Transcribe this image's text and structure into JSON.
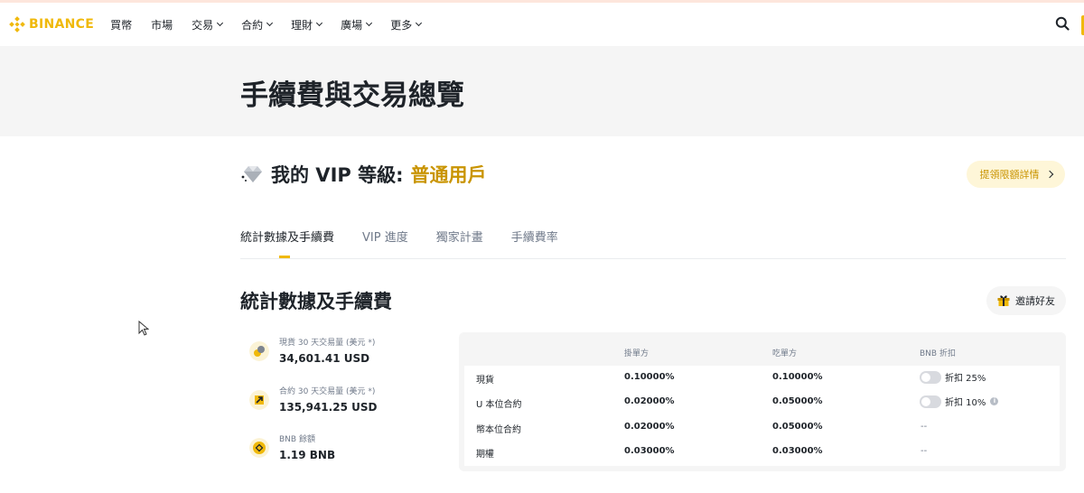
{
  "header": {
    "brand": "BINANCE",
    "nav": [
      {
        "label": "買幣",
        "has_dropdown": false
      },
      {
        "label": "市場",
        "has_dropdown": false
      },
      {
        "label": "交易",
        "has_dropdown": true
      },
      {
        "label": "合約",
        "has_dropdown": true
      },
      {
        "label": "理財",
        "has_dropdown": true
      },
      {
        "label": "廣場",
        "has_dropdown": true
      },
      {
        "label": "更多",
        "has_dropdown": true
      }
    ],
    "search_icon": "search-icon"
  },
  "page": {
    "title": "手續費與交易總覽"
  },
  "vip": {
    "prefix": "我的 VIP 等級:",
    "level": "普通用戶",
    "icon": "diamond-icon",
    "limit_button": "提領限額詳情"
  },
  "tabs": [
    {
      "label": "統計數據及手續費",
      "active": true
    },
    {
      "label": "VIP 進度",
      "active": false
    },
    {
      "label": "獨家計畫",
      "active": false
    },
    {
      "label": "手續費率",
      "active": false
    }
  ],
  "stats_section": {
    "title": "統計數據及手續費",
    "invite_button": "邀請好友",
    "items": [
      {
        "label": "現貨 30 天交易量 (美元 *)",
        "value": "34,601.41 USD",
        "icon": "spot-volume-icon"
      },
      {
        "label": "合約 30 天交易量 (美元 *)",
        "value": "135,941.25 USD",
        "icon": "futures-volume-icon"
      },
      {
        "label": "BNB 餘額",
        "value": "1.19 BNB",
        "icon": "bnb-coin-icon"
      }
    ]
  },
  "fee_table": {
    "headers": [
      "",
      "掛單方",
      "吃單方",
      "BNB 折扣"
    ],
    "rows": [
      {
        "type": "現貨",
        "maker": "0.10000%",
        "taker": "0.10000%",
        "discount": "折扣 25%",
        "has_toggle": true,
        "has_info": false
      },
      {
        "type": "U 本位合約",
        "maker": "0.02000%",
        "taker": "0.05000%",
        "discount": "折扣 10%",
        "has_toggle": true,
        "has_info": true
      },
      {
        "type": "幣本位合約",
        "maker": "0.02000%",
        "taker": "0.05000%",
        "discount": "--",
        "has_toggle": false,
        "has_info": false
      },
      {
        "type": "期權",
        "maker": "0.03000%",
        "taker": "0.03000%",
        "discount": "--",
        "has_toggle": false,
        "has_info": false
      }
    ]
  },
  "colors": {
    "brand": "#f0b90b",
    "accent_text": "#c99400",
    "primary_text": "#1e2329",
    "secondary_text": "#707a8a",
    "band_bg": "#f5f5f5"
  }
}
